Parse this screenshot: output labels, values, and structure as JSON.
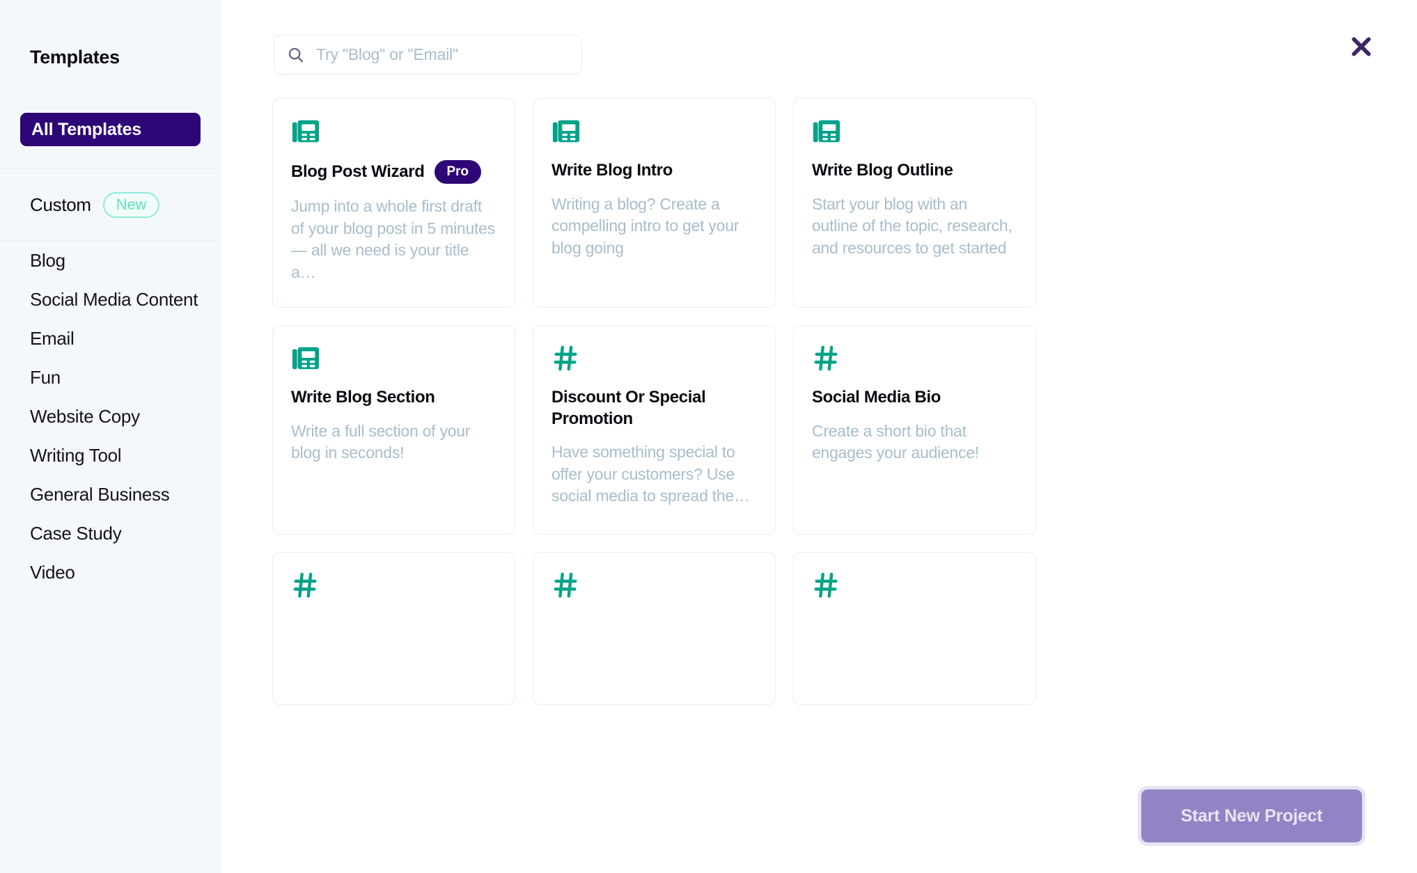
{
  "sidebar": {
    "title": "Templates",
    "all_templates_label": "All Templates",
    "custom_label": "Custom",
    "new_chip_label": "New",
    "nav_items": [
      {
        "label": "Blog"
      },
      {
        "label": "Social Media Content"
      },
      {
        "label": "Email"
      },
      {
        "label": "Fun"
      },
      {
        "label": "Website Copy"
      },
      {
        "label": "Writing Tool"
      },
      {
        "label": "General Business"
      },
      {
        "label": "Case Study"
      },
      {
        "label": "Video"
      }
    ]
  },
  "search": {
    "placeholder": "Try \"Blog\" or \"Email\"",
    "value": "",
    "icon": "search-icon"
  },
  "close": {
    "icon": "close-icon"
  },
  "cards": [
    {
      "icon": "newspaper-icon",
      "title": "Blog Post Wizard",
      "badge": "Pro",
      "description": "Jump into a whole first draft of your blog post in 5 minutes — all we need is your title a…"
    },
    {
      "icon": "newspaper-icon",
      "title": "Write Blog Intro",
      "badge": "",
      "description": "Writing a blog? Create a compelling intro to get your blog going"
    },
    {
      "icon": "newspaper-icon",
      "title": "Write Blog Outline",
      "badge": "",
      "description": "Start your blog with an outline of the topic, research, and resources to get started"
    },
    {
      "icon": "newspaper-icon",
      "title": "Write Blog Section",
      "badge": "",
      "description": "Write a full section of your blog in seconds!"
    },
    {
      "icon": "hashtag-icon",
      "title": "Discount Or Special Promotion",
      "badge": "",
      "description": "Have something special to offer your customers? Use social media to spread the…"
    },
    {
      "icon": "hashtag-icon",
      "title": "Social Media Bio",
      "badge": "",
      "description": "Create a short bio that engages your audience!"
    }
  ],
  "cards_partial": [
    {
      "icon": "hashtag-icon",
      "title": "",
      "badge": "",
      "description": ""
    },
    {
      "icon": "hashtag-icon",
      "title": "",
      "badge": "",
      "description": ""
    },
    {
      "icon": "hashtag-icon",
      "title": "",
      "badge": "",
      "description": ""
    }
  ],
  "cta": {
    "label": "Start New Project"
  },
  "colors": {
    "accent_indigo": "#2E0777",
    "icon_teal": "#00A388",
    "mint": "#62E3C6",
    "muted_text": "#A8BDCB",
    "cta_purple": "#9284C4",
    "sidebar_bg": "#F4F8FA"
  }
}
